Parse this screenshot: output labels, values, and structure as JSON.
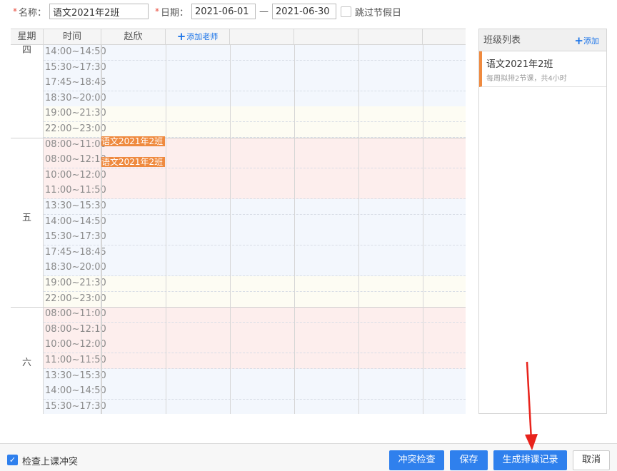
{
  "form": {
    "required_mark": "*",
    "name_label": "名称：",
    "name_value": "语文2021年2班",
    "date_label": "日期：",
    "date_from": "2021-06-01",
    "date_sep": "—",
    "date_to": "2021-06-30",
    "skip_holidays_label": "跳过节假日",
    "skip_holidays_checked": false
  },
  "schedule": {
    "headers": {
      "weekday": "星期",
      "time": "时间",
      "teacher": "赵欣",
      "add_teacher": "添加老师",
      "add_icon": "plus-icon"
    },
    "days": [
      {
        "label": "四",
        "slots": [
          "14:00~14:50",
          "15:30~17:30",
          "17:45~18:45",
          "18:30~20:00",
          "19:00~21:30",
          "22:00~23:00"
        ]
      },
      {
        "label": "五",
        "slots": [
          "08:00~11:00",
          "08:00~12:10",
          "10:00~12:00",
          "11:00~11:50",
          "13:30~15:30",
          "14:00~14:50",
          "15:30~17:30",
          "17:45~18:45",
          "18:30~20:00",
          "19:00~21:30",
          "22:00~23:00"
        ]
      },
      {
        "label": "六",
        "slots": [
          "08:00~11:00",
          "08:00~12:10",
          "10:00~12:00",
          "11:00~11:50",
          "13:30~15:30",
          "14:00~14:50",
          "15:30~17:30"
        ]
      }
    ],
    "lessons": [
      {
        "label": "语文2021年2班"
      },
      {
        "label": "语文2021年2班"
      }
    ],
    "colors": {
      "lesson": "#ef8a3f",
      "morning": "#fdeeed",
      "afternoon": "#f3f7fd",
      "evening": "#fdfcf3"
    }
  },
  "class_panel": {
    "title": "班级列表",
    "add_label": "添加",
    "add_icon": "plus-icon",
    "items": [
      {
        "name": "语文2021年2班",
        "desc": "每周拟排2节课，共4小时"
      }
    ]
  },
  "footer": {
    "check_conflict_label": "检查上课冲突",
    "check_conflict_checked": true,
    "buttons": {
      "conflict_check": "冲突检查",
      "save": "保存",
      "generate": "生成排课记录",
      "cancel": "取消"
    },
    "accent": "#2f80ed"
  }
}
